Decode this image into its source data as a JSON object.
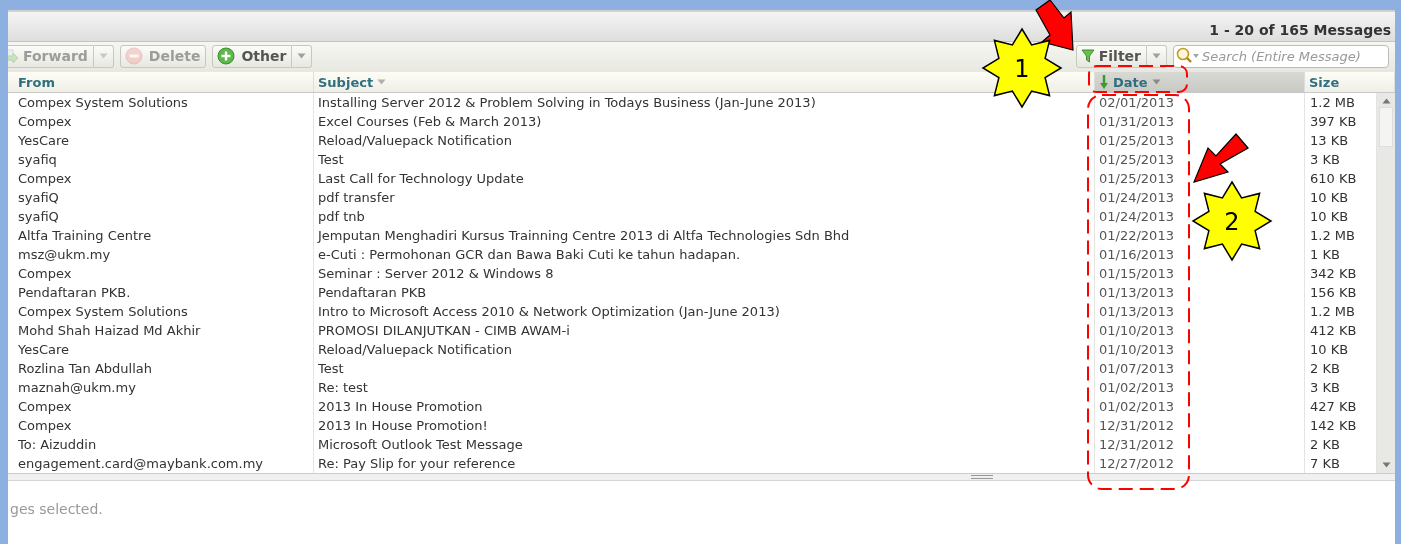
{
  "status": {
    "text": "1 - 20 of 165 Messages"
  },
  "toolbar": {
    "buttons": [
      {
        "label": "Forward",
        "kind": "forward",
        "disabled": true,
        "has_menu": true
      },
      {
        "label": "Delete",
        "kind": "delete",
        "disabled": true,
        "has_menu": false
      },
      {
        "label": "Other",
        "kind": "other",
        "disabled": false,
        "has_menu": true
      }
    ],
    "filter": {
      "label": "Filter",
      "has_menu": true
    },
    "search": {
      "placeholder": "Search (Entire Message)"
    }
  },
  "columns": [
    {
      "label": "From",
      "sorted": false,
      "has_menu": false
    },
    {
      "label": "Subject",
      "sorted": false,
      "has_menu": true
    },
    {
      "label": "Date",
      "sorted": true,
      "has_menu": true
    },
    {
      "label": "Size",
      "sorted": false,
      "has_menu": false
    }
  ],
  "rows": [
    {
      "from": "Compex System Solutions",
      "subject": "Installing Server 2012 & Problem Solving in Todays Business (Jan-June 2013)",
      "date": "02/01/2013",
      "size": "1.2 MB"
    },
    {
      "from": "Compex",
      "subject": "Excel Courses (Feb & March 2013)",
      "date": "01/31/2013",
      "size": "397 KB"
    },
    {
      "from": "YesCare",
      "subject": "Reload/Valuepack Notification",
      "date": "01/25/2013",
      "size": "13 KB"
    },
    {
      "from": "syafiq",
      "subject": "Test",
      "date": "01/25/2013",
      "size": "3 KB"
    },
    {
      "from": "Compex",
      "subject": "Last Call for Technology Update",
      "date": "01/25/2013",
      "size": "610 KB"
    },
    {
      "from": "syafiQ",
      "subject": "pdf transfer",
      "date": "01/24/2013",
      "size": "10 KB"
    },
    {
      "from": "syafiQ",
      "subject": "pdf tnb",
      "date": "01/24/2013",
      "size": "10 KB"
    },
    {
      "from": "Altfa Training Centre",
      "subject": "Jemputan Menghadiri Kursus Trainning Centre 2013 di Altfa Technologies Sdn Bhd",
      "date": "01/22/2013",
      "size": "1.2 MB"
    },
    {
      "from": "msz@ukm.my",
      "subject": "e-Cuti : Permohonan GCR dan Bawa Baki Cuti ke tahun hadapan.",
      "date": "01/16/2013",
      "size": "1 KB"
    },
    {
      "from": "Compex",
      "subject": "Seminar : Server 2012 & Windows 8",
      "date": "01/15/2013",
      "size": "342 KB"
    },
    {
      "from": "Pendaftaran PKB.",
      "subject": "Pendaftaran PKB",
      "date": "01/13/2013",
      "size": "156 KB"
    },
    {
      "from": "Compex System Solutions",
      "subject": "Intro to Microsoft Access 2010 & Network Optimization (Jan-June 2013)",
      "date": "01/13/2013",
      "size": "1.2 MB"
    },
    {
      "from": "Mohd Shah Haizad Md Akhir",
      "subject": "PROMOSI DILANJUTKAN - CIMB AWAM-i",
      "date": "01/10/2013",
      "size": "412 KB"
    },
    {
      "from": "YesCare",
      "subject": "Reload/Valuepack Notification",
      "date": "01/10/2013",
      "size": "10 KB"
    },
    {
      "from": "Rozlina Tan Abdullah",
      "subject": "Test",
      "date": "01/07/2013",
      "size": "2 KB"
    },
    {
      "from": "maznah@ukm.my",
      "subject": "Re: test",
      "date": "01/02/2013",
      "size": "3 KB"
    },
    {
      "from": "Compex",
      "subject": "2013 In House Promotion",
      "date": "01/02/2013",
      "size": "427 KB"
    },
    {
      "from": "Compex",
      "subject": "2013 In House Promotion!",
      "date": "12/31/2012",
      "size": "142 KB"
    },
    {
      "from": "To: Aizuddin",
      "subject": "Microsoft Outlook Test Message",
      "date": "12/31/2012",
      "size": "2 KB"
    },
    {
      "from": "engagement.card@maybank.com.my",
      "subject": "Re: Pay Slip for your reference",
      "date": "12/27/2012",
      "size": "7 KB"
    }
  ],
  "preview": {
    "text": "ges selected."
  },
  "annotations": [
    {
      "number": "1"
    },
    {
      "number": "2"
    }
  ]
}
